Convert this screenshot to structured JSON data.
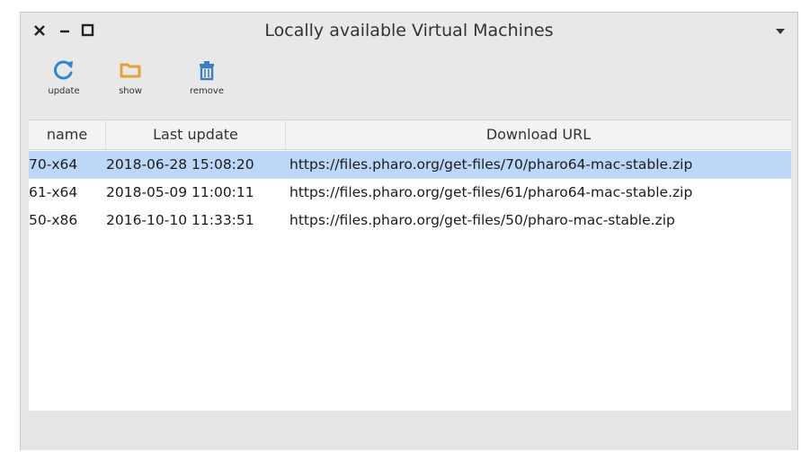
{
  "window": {
    "title": "Locally available Virtual Machines",
    "controls": {
      "close": "×",
      "minimize": "–",
      "maximize": "□"
    }
  },
  "toolbar": {
    "update_label": "update",
    "show_label": "show",
    "remove_label": "remove"
  },
  "table": {
    "columns": [
      "name",
      "Last update",
      "Download URL"
    ],
    "rows": [
      {
        "name": "70-x64",
        "last_update": "2018-06-28 15:08:20",
        "url": "https://files.pharo.org/get-files/70/pharo64-mac-stable.zip",
        "selected": true
      },
      {
        "name": "61-x64",
        "last_update": "2018-05-09 11:00:11",
        "url": "https://files.pharo.org/get-files/61/pharo64-mac-stable.zip",
        "selected": false
      },
      {
        "name": "50-x86",
        "last_update": "2016-10-10 11:33:51",
        "url": "https://files.pharo.org/get-files/50/pharo-mac-stable.zip",
        "selected": false
      }
    ]
  },
  "colors": {
    "selection": "#bcd7f7",
    "update_icon": "#2f86d1",
    "folder_icon": "#e2a236",
    "trash_icon": "#3a7fc1"
  },
  "icons": [
    "close-icon",
    "minimize-icon",
    "maximize-icon",
    "window-menu-icon",
    "refresh-icon",
    "folder-icon",
    "trash-icon"
  ]
}
